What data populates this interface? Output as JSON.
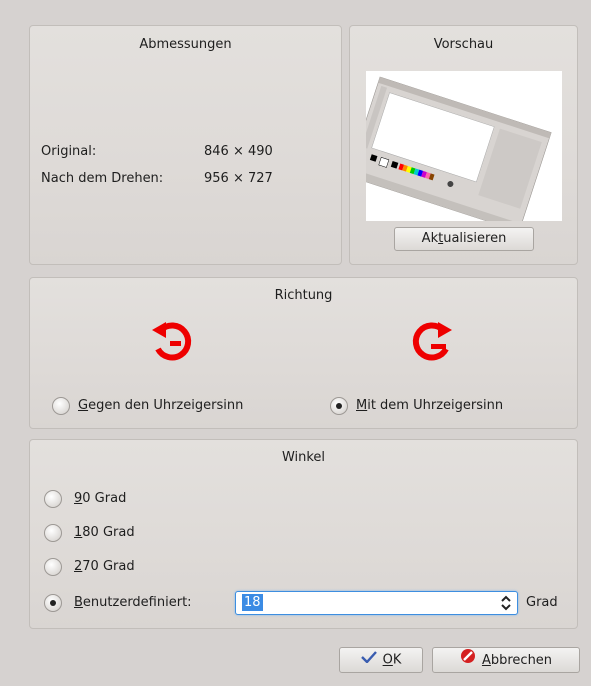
{
  "dimensions": {
    "title": "Abmessungen",
    "original_label": "Original:",
    "original_value": "846 × 490",
    "rotated_label": "Nach dem Drehen:",
    "rotated_value": "956 × 727"
  },
  "preview": {
    "title": "Vorschau",
    "refresh_prefix": "Ak",
    "refresh_accel": "t",
    "refresh_suffix": "ualisieren"
  },
  "direction": {
    "title": "Richtung",
    "ccw_accel": "G",
    "ccw_rest": "egen den Uhrzeigersinn",
    "cw_accel": "M",
    "cw_rest": "it dem Uhrzeigersinn",
    "selected": "cw",
    "arrow_color": "#ee0000"
  },
  "angle": {
    "title": "Winkel",
    "options": [
      {
        "accel": "9",
        "rest": "0 Grad",
        "selected": false
      },
      {
        "accel": "1",
        "rest": "80 Grad",
        "selected": false
      },
      {
        "accel": "2",
        "rest": "70 Grad",
        "selected": false
      },
      {
        "accel": "B",
        "rest": "enutzerdefiniert:",
        "selected": true
      }
    ],
    "custom_value": "18",
    "unit": "Grad"
  },
  "footer": {
    "ok_accel": "O",
    "ok_rest": "K",
    "cancel_accel": "A",
    "cancel_rest": "bbrechen"
  }
}
